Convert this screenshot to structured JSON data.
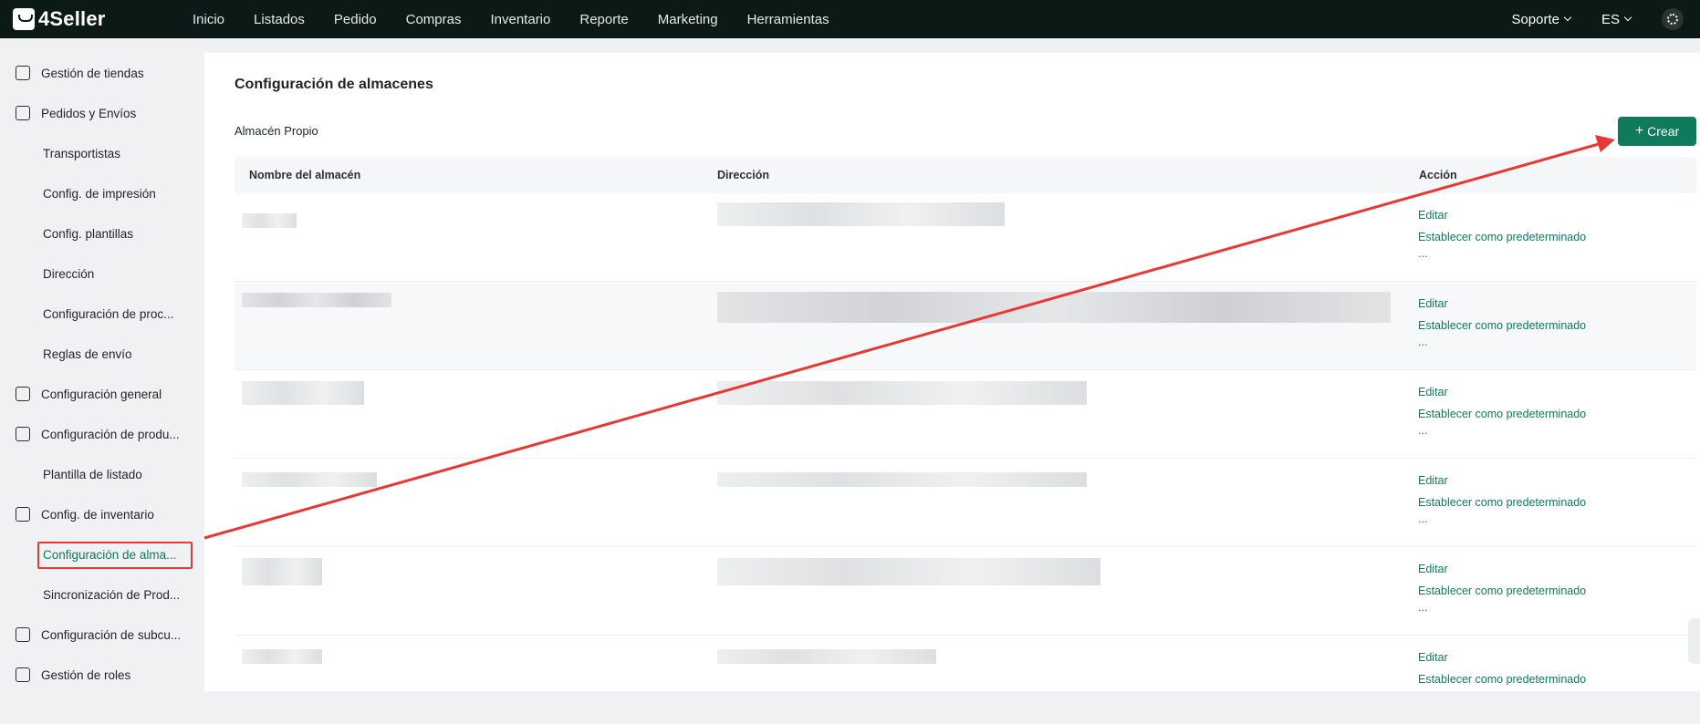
{
  "app": {
    "logo_text": "4Seller"
  },
  "nav": [
    "Inicio",
    "Listados",
    "Pedido",
    "Compras",
    "Inventario",
    "Reporte",
    "Marketing",
    "Herramientas"
  ],
  "top_right": {
    "support": "Soporte",
    "language": "ES"
  },
  "sidebar": {
    "items": [
      {
        "label": "Gestión de tiendas",
        "icon": "store-icon"
      },
      {
        "label": "Pedidos y Envíos",
        "icon": "clipboard-icon"
      },
      {
        "label": "Transportistas"
      },
      {
        "label": "Config. de impresión"
      },
      {
        "label": "Config. plantillas"
      },
      {
        "label": "Dirección"
      },
      {
        "label": "Configuración de proc..."
      },
      {
        "label": "Reglas de envío"
      },
      {
        "label": "Configuración general",
        "icon": "printer-icon"
      },
      {
        "label": "Configuración de produ...",
        "icon": "box-upload-icon"
      },
      {
        "label": "Plantilla de listado"
      },
      {
        "label": "Config. de inventario",
        "icon": "warehouse-icon"
      },
      {
        "label": "Configuración de alma..."
      },
      {
        "label": "Sincronización de Prod..."
      },
      {
        "label": "Configuración de subcu...",
        "icon": "id-badge-icon"
      },
      {
        "label": "Gestión de roles",
        "icon": "user-icon"
      }
    ]
  },
  "main": {
    "title": "Configuración de almacenes",
    "section_label": "Almacén Propio",
    "create_button": "Crear",
    "table": {
      "headers": [
        "Nombre del almacén",
        "Dirección",
        "Acción"
      ],
      "action_labels": {
        "edit": "Editar",
        "set_default": "Establecer como predeterminado",
        "more": "..."
      }
    }
  },
  "colors": {
    "brand": "#0f7a5c",
    "topbar": "#0c1a17",
    "highlight": "#e53935"
  }
}
